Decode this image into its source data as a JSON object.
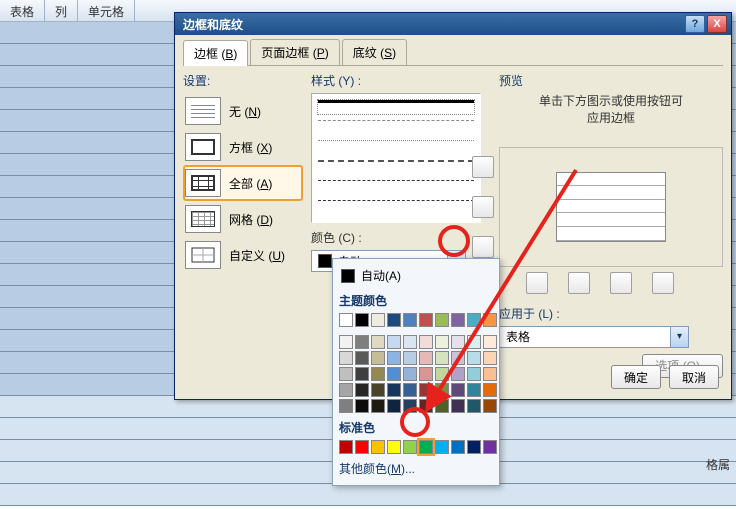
{
  "toolbar": {
    "table": "表格",
    "col": "列",
    "cell": "单元格"
  },
  "dialog": {
    "title": "边框和底纹",
    "help": "?",
    "close": "X",
    "tabs": {
      "border": "边框",
      "border_k": "B",
      "page": "页面边框",
      "page_k": "P",
      "shading": "底纹",
      "shading_k": "S"
    },
    "settings": {
      "label": "设置:",
      "none": "无",
      "none_k": "N",
      "box": "方框",
      "box_k": "X",
      "all": "全部",
      "all_k": "A",
      "grid": "网格",
      "grid_k": "D",
      "custom": "自定义",
      "custom_k": "U"
    },
    "style": {
      "label": "样式",
      "label_k": "Y"
    },
    "color": {
      "label": "颜色",
      "label_k": "C",
      "value": "自动"
    },
    "preview": {
      "label": "预览",
      "hint1": "单击下方图示或使用按钮可",
      "hint2": "应用边框"
    },
    "apply": {
      "label": "应用于",
      "label_k": "L",
      "value": "表格"
    },
    "options": "选项",
    "options_k": "O",
    "ok": "确定",
    "cancel": "取消"
  },
  "popup": {
    "auto": "自动",
    "auto_k": "A",
    "theme_label": "主题颜色",
    "theme_row1": [
      "#ffffff",
      "#000000",
      "#eeece1",
      "#1f497d",
      "#4f81bd",
      "#c0504d",
      "#9bbb59",
      "#8064a2",
      "#4bacc6",
      "#f79646"
    ],
    "theme_shades": [
      [
        "#f2f2f2",
        "#7f7f7f",
        "#ddd9c3",
        "#c6d9f0",
        "#dbe5f1",
        "#f2dcdb",
        "#ebf1dd",
        "#e5e0ec",
        "#dbeef3",
        "#fdeada"
      ],
      [
        "#d8d8d8",
        "#595959",
        "#c4bd97",
        "#8db3e2",
        "#b8cce4",
        "#e5b9b7",
        "#d7e3bc",
        "#ccc1d9",
        "#b7dde8",
        "#fbd5b5"
      ],
      [
        "#bfbfbf",
        "#3f3f3f",
        "#938953",
        "#548dd4",
        "#95b3d7",
        "#d99694",
        "#c3d69b",
        "#b2a1c7",
        "#92cddc",
        "#fac08f"
      ],
      [
        "#a5a5a5",
        "#262626",
        "#494429",
        "#17365d",
        "#366092",
        "#953734",
        "#76923c",
        "#5f497a",
        "#31859b",
        "#e36c09"
      ],
      [
        "#7f7f7f",
        "#0c0c0c",
        "#1d1b10",
        "#0f243e",
        "#244061",
        "#632423",
        "#4f6128",
        "#3f3151",
        "#205867",
        "#974806"
      ]
    ],
    "standard_label": "标准色",
    "standard": [
      "#c00000",
      "#ff0000",
      "#ffc000",
      "#ffff00",
      "#92d050",
      "#00b050",
      "#00b0f0",
      "#0070c0",
      "#002060",
      "#7030a0"
    ],
    "more": "其他颜色",
    "more_k": "M"
  },
  "torn": "格属"
}
